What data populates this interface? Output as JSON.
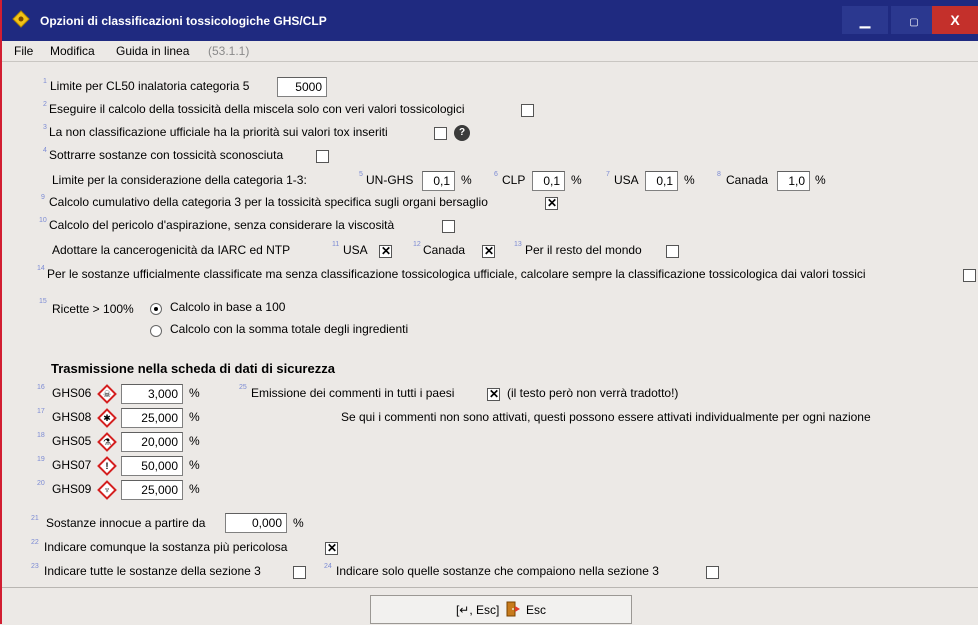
{
  "window": {
    "title": "Opzioni di classificazioni tossicologiche GHS/CLP",
    "min_icon": "minimize-icon",
    "max_icon": "maximize-icon",
    "close_icon": "close-icon"
  },
  "menu": {
    "file": "File",
    "modifica": "Modifica",
    "guida": "Guida in linea",
    "version": "(53.1.1)"
  },
  "options": {
    "o1": {
      "num": "1",
      "label": "Limite per CL50 inalatoria categoria 5",
      "value": "5000"
    },
    "o2": {
      "num": "2",
      "label": "Eseguire il calcolo della tossicità della miscela solo con veri valori tossicologici",
      "checked": false
    },
    "o3": {
      "num": "3",
      "label": "La non classificazione ufficiale ha la priorità sui valori tox inseriti",
      "checked": false,
      "help": "?"
    },
    "o4": {
      "num": "4",
      "label": "Sottrarre sostanze con tossicità sconosciuta",
      "checked": false
    },
    "limits": {
      "label": "Limite per la considerazione della categoria 1-3:",
      "items": [
        {
          "num": "5",
          "label": "UN-GHS",
          "value": "0,1",
          "unit": "%"
        },
        {
          "num": "6",
          "label": "CLP",
          "value": "0,1",
          "unit": "%"
        },
        {
          "num": "7",
          "label": "USA",
          "value": "0,1",
          "unit": "%"
        },
        {
          "num": "8",
          "label": "Canada",
          "value": "1,0",
          "unit": "%"
        }
      ]
    },
    "o9": {
      "num": "9",
      "label": "Calcolo cumulativo della categoria 3 per la tossicità specifica sugli organi bersaglio",
      "checked": true
    },
    "o10": {
      "num": "10",
      "label": "Calcolo del pericolo d'aspirazione, senza considerare la viscosità",
      "checked": false
    },
    "iarc": {
      "label": "Adottare la cancerogenicità da IARC ed NTP",
      "items": [
        {
          "num": "11",
          "label": "USA",
          "checked": true
        },
        {
          "num": "12",
          "label": "Canada",
          "checked": true
        },
        {
          "num": "13",
          "label": "Per il resto del mondo",
          "checked": false
        }
      ]
    },
    "o14": {
      "num": "14",
      "label": "Per le sostanze ufficialmente classificate ma senza classificazione tossicologica ufficiale, calcolare sempre la classificazione tossicologica dai valori tossici",
      "checked": false
    },
    "o15": {
      "num": "15",
      "label": "Ricette > 100%",
      "radio1": "Calcolo in base a 100",
      "radio2": "Calcolo con la somma totale degli ingredienti",
      "selected": 1
    }
  },
  "sds": {
    "heading": "Trasmissione nella scheda di dati di sicurezza",
    "ghs": [
      {
        "num": "16",
        "label": "GHS06",
        "icon": "skull-pictogram-icon",
        "value": "3,000",
        "unit": "%"
      },
      {
        "num": "17",
        "label": "GHS08",
        "icon": "health-hazard-pictogram-icon",
        "value": "25,000",
        "unit": "%"
      },
      {
        "num": "18",
        "label": "GHS05",
        "icon": "corrosion-pictogram-icon",
        "value": "20,000",
        "unit": "%"
      },
      {
        "num": "19",
        "label": "GHS07",
        "icon": "exclamation-pictogram-icon",
        "value": "50,000",
        "unit": "%"
      },
      {
        "num": "20",
        "label": "GHS09",
        "icon": "environment-pictogram-icon",
        "value": "25,000",
        "unit": "%"
      }
    ],
    "comments": {
      "num": "25",
      "label": "Emissione dei commenti in tutti i paesi",
      "checked": true,
      "note": "(il testo però non verrà tradotto!)"
    },
    "comments_info": "Se qui i commenti non sono attivati, questi possono essere attivati individualmente per ogni nazione"
  },
  "bottom_opts": {
    "o21": {
      "num": "21",
      "label": "Sostanze innocue a partire da",
      "value": "0,000",
      "unit": "%"
    },
    "o22": {
      "num": "22",
      "label": "Indicare comunque la sostanza più pericolosa",
      "checked": true
    },
    "o23": {
      "num": "23",
      "label": "Indicare tutte le sostanze della sezione 3",
      "checked": false
    },
    "o24": {
      "num": "24",
      "label": "Indicare solo quelle sostanze che compaiono nella sezione 3",
      "checked": false
    }
  },
  "footer": {
    "button": "[↵, Esc]",
    "button_label": "Esc",
    "icon": "exit-door-icon"
  },
  "colors": {
    "titlebar": "#1f2a80",
    "accent_red": "#d21e32",
    "background": "#ece9e6"
  }
}
